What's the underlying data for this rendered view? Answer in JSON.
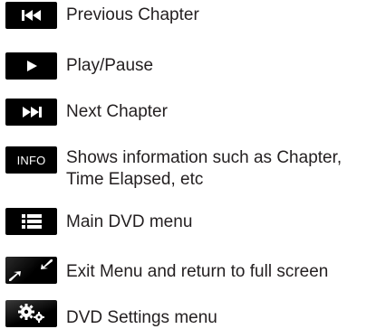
{
  "legend": {
    "items": [
      {
        "icon": "previous-chapter-icon",
        "label_lines": [
          "Previous Chapter"
        ]
      },
      {
        "icon": "play-pause-icon",
        "label_lines": [
          "Play/Pause"
        ]
      },
      {
        "icon": "next-chapter-icon",
        "label_lines": [
          "Next Chapter"
        ]
      },
      {
        "icon": "info-icon",
        "icon_text": "INFO",
        "label_lines": [
          "Shows information such as Chapter,",
          "Time Elapsed, etc"
        ]
      },
      {
        "icon": "main-menu-icon",
        "label_lines": [
          "Main DVD menu"
        ]
      },
      {
        "icon": "exit-fullscreen-icon",
        "label_lines": [
          "Exit Menu and return to full screen"
        ]
      },
      {
        "icon": "settings-gears-icon",
        "label_lines": [
          "DVD Settings menu"
        ]
      }
    ]
  },
  "colors": {
    "icon_background": "#000000",
    "icon_foreground": "#ffffff",
    "text": "#231f20",
    "page_background": "#ffffff"
  }
}
